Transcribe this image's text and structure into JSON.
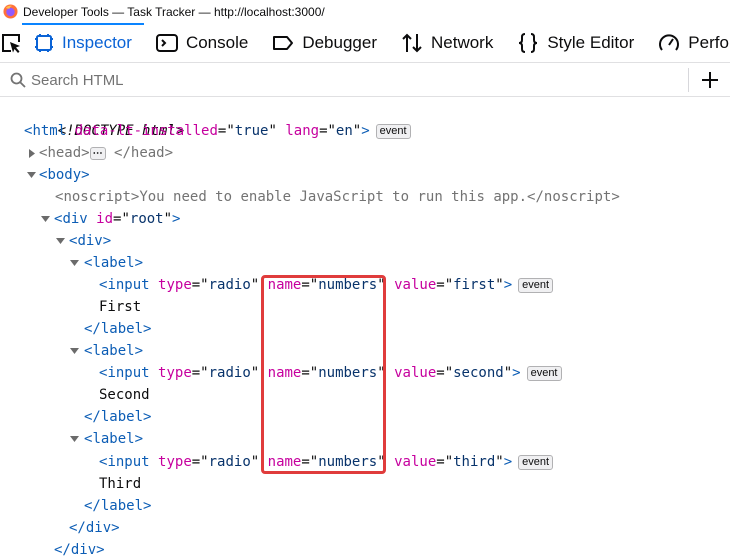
{
  "window": {
    "title": "Developer Tools — Task Tracker — http://localhost:3000/",
    "app_icon": "firefox-icon"
  },
  "toolbar": {
    "tabs": [
      {
        "label": "Inspector",
        "icon": "inspector-icon",
        "active": true
      },
      {
        "label": "Console",
        "icon": "console-icon",
        "active": false
      },
      {
        "label": "Debugger",
        "icon": "debugger-icon",
        "active": false
      },
      {
        "label": "Network",
        "icon": "network-icon",
        "active": false
      },
      {
        "label": "Style Editor",
        "icon": "style-editor-icon",
        "active": false
      },
      {
        "label": "Perfo",
        "icon": "performance-icon",
        "active": false
      }
    ]
  },
  "search": {
    "placeholder": "Search HTML",
    "value": ""
  },
  "markup": {
    "doctype": "<!DOCTYPE html>",
    "html_open": {
      "tag": "html",
      "attrs": [
        {
          "name": "data-lt-installed",
          "value": "true"
        },
        {
          "name": "lang",
          "value": "en"
        }
      ],
      "badge": "event"
    },
    "head": {
      "tag": "head",
      "collapsed_marker": "⋯"
    },
    "body_tag": "body",
    "noscript": {
      "tag": "noscript",
      "text": "You need to enable JavaScript to run this app."
    },
    "root_div": {
      "tag": "div",
      "attr": {
        "name": "id",
        "value": "root"
      }
    },
    "inner_div_tag": "div",
    "labels": [
      {
        "tag": "label",
        "input_tag": "input",
        "type_attr": {
          "name": "type",
          "value": "radio"
        },
        "name_attr": {
          "name": "name",
          "value": "numbers"
        },
        "value_attr": {
          "name": "value",
          "value": "first"
        },
        "badge": "event",
        "text": "First"
      },
      {
        "tag": "label",
        "input_tag": "input",
        "type_attr": {
          "name": "type",
          "value": "radio"
        },
        "name_attr": {
          "name": "name",
          "value": "numbers"
        },
        "value_attr": {
          "name": "value",
          "value": "second"
        },
        "badge": "event",
        "text": "Second"
      },
      {
        "tag": "label",
        "input_tag": "input",
        "type_attr": {
          "name": "type",
          "value": "radio"
        },
        "name_attr": {
          "name": "name",
          "value": "numbers"
        },
        "value_attr": {
          "name": "value",
          "value": "third"
        },
        "badge": "event",
        "text": "Third"
      }
    ]
  },
  "colors": {
    "accent": "#0a84ff",
    "tag": "#0c5db5",
    "attribute": "#c6009e",
    "value": "#08336b",
    "highlight": "#e03c3c"
  }
}
